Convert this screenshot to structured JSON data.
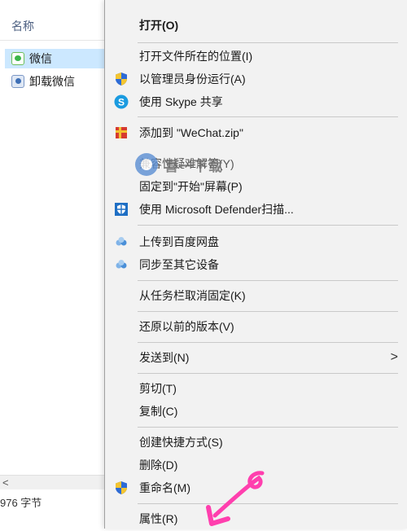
{
  "explorer": {
    "column_header": "名称",
    "files": [
      {
        "name": "微信",
        "icon": "wechat-icon",
        "selected": true
      },
      {
        "name": "卸载微信",
        "icon": "uninstall-icon",
        "selected": false
      }
    ],
    "scroll_left_glyph": "<",
    "status_text": "976 字节"
  },
  "context_menu": {
    "items": [
      {
        "label": "打开(O)",
        "icon": null,
        "bold": true
      },
      {
        "label": "打开文件所在的位置(I)",
        "icon": null
      },
      {
        "label": "以管理员身份运行(A)",
        "icon": "uac-shield-icon"
      },
      {
        "label": "使用 Skype 共享",
        "icon": "skype-icon"
      },
      {
        "label": "添加到 \"WeChat.zip\"",
        "icon": "archive-icon"
      },
      {
        "label": "兼容性疑难解答(Y)",
        "icon": null
      },
      {
        "label": "固定到\"开始\"屏幕(P)",
        "icon": null
      },
      {
        "label": "使用 Microsoft Defender扫描...",
        "icon": "defender-icon"
      },
      {
        "label": "上传到百度网盘",
        "icon": "baidu-cloud-icon"
      },
      {
        "label": "同步至其它设备",
        "icon": "baidu-cloud-icon"
      },
      {
        "label": "从任务栏取消固定(K)",
        "icon": null
      },
      {
        "label": "还原以前的版本(V)",
        "icon": null
      },
      {
        "label": "发送到(N)",
        "icon": null,
        "submenu_glyph": ">"
      },
      {
        "label": "剪切(T)",
        "icon": null
      },
      {
        "label": "复制(C)",
        "icon": null
      },
      {
        "label": "创建快捷方式(S)",
        "icon": null
      },
      {
        "label": "删除(D)",
        "icon": null
      },
      {
        "label": "重命名(M)",
        "icon": "uac-shield-icon"
      },
      {
        "label": "属性(R)",
        "icon": null
      }
    ]
  },
  "watermark": {
    "text": "喜一下载"
  },
  "colors": {
    "menu_bg": "#f2f2f2",
    "selection": "#cce8ff",
    "annotation": "#ff3fae"
  }
}
